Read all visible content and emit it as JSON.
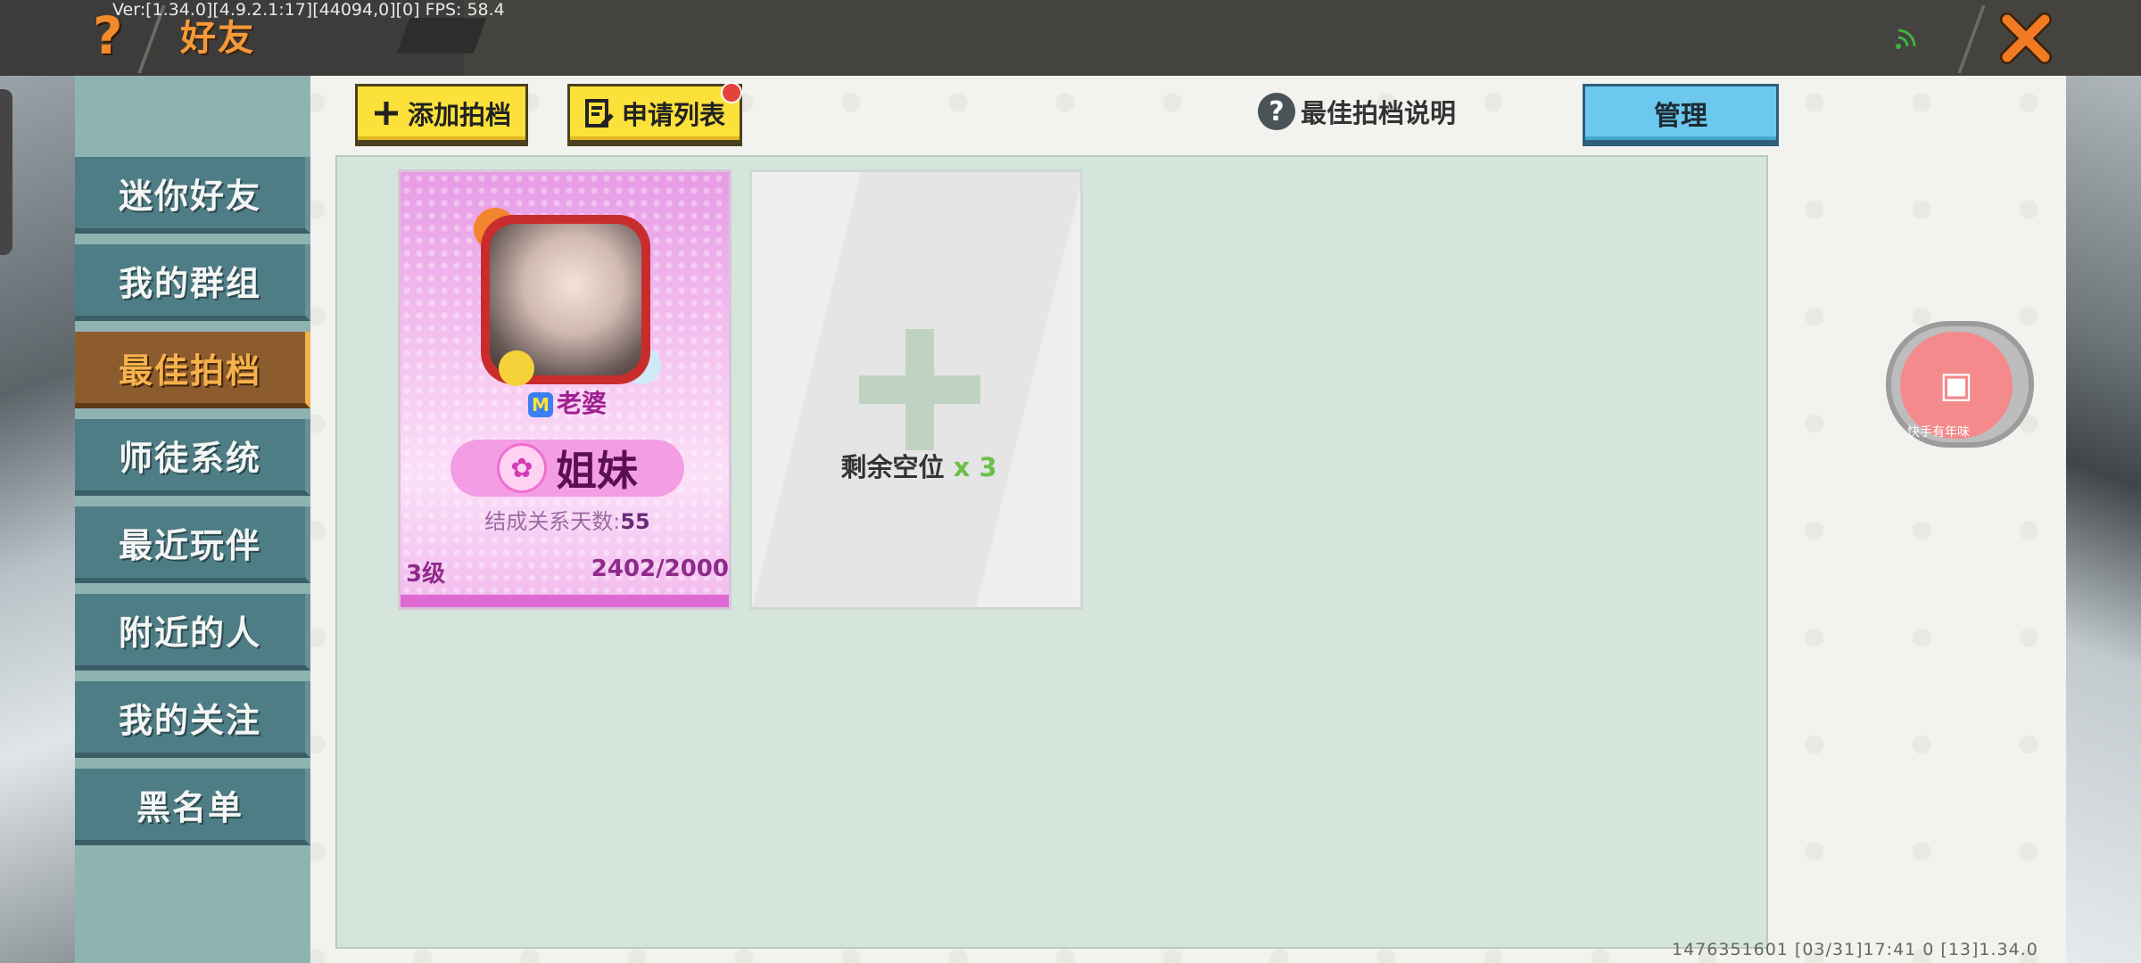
{
  "topbar": {
    "title": "好友",
    "debug": "Ver:[1.34.0][4.9.2.1:17][44094,0][0] FPS: 58.4"
  },
  "sidebar": {
    "items": [
      {
        "label": "迷你好友",
        "active": false
      },
      {
        "label": "我的群组",
        "active": false
      },
      {
        "label": "最佳拍档",
        "active": true
      },
      {
        "label": "师徒系统",
        "active": false
      },
      {
        "label": "最近玩伴",
        "active": false
      },
      {
        "label": "附近的人",
        "active": false
      },
      {
        "label": "我的关注",
        "active": false
      },
      {
        "label": "黑名单",
        "active": false
      }
    ]
  },
  "toolbar": {
    "add_partner_label": "添加拍档",
    "apply_list_label": "申请列表",
    "help_label": "最佳拍档说明",
    "manage_label": "管理"
  },
  "partner_card": {
    "role": "老婆",
    "relation": "姐妹",
    "days_label": "结成关系天数:",
    "days_value": "55",
    "level": "3级",
    "xp": "2402/2000"
  },
  "empty_slot": {
    "label": "剩余空位",
    "count": "x 3"
  },
  "video_bubble": {
    "label": "快手有年味"
  },
  "footer": {
    "info": "1476351601   [03/31]17:41 0  [13]1.34.0"
  },
  "colors": {
    "accent_orange": "#f59a3a",
    "sidebar_active": "#8c5b2e",
    "sidebar_item": "#4f7d86",
    "button_yellow": "#fbe13a",
    "button_blue": "#6cc8ee",
    "card_pink": "#e79be6"
  }
}
